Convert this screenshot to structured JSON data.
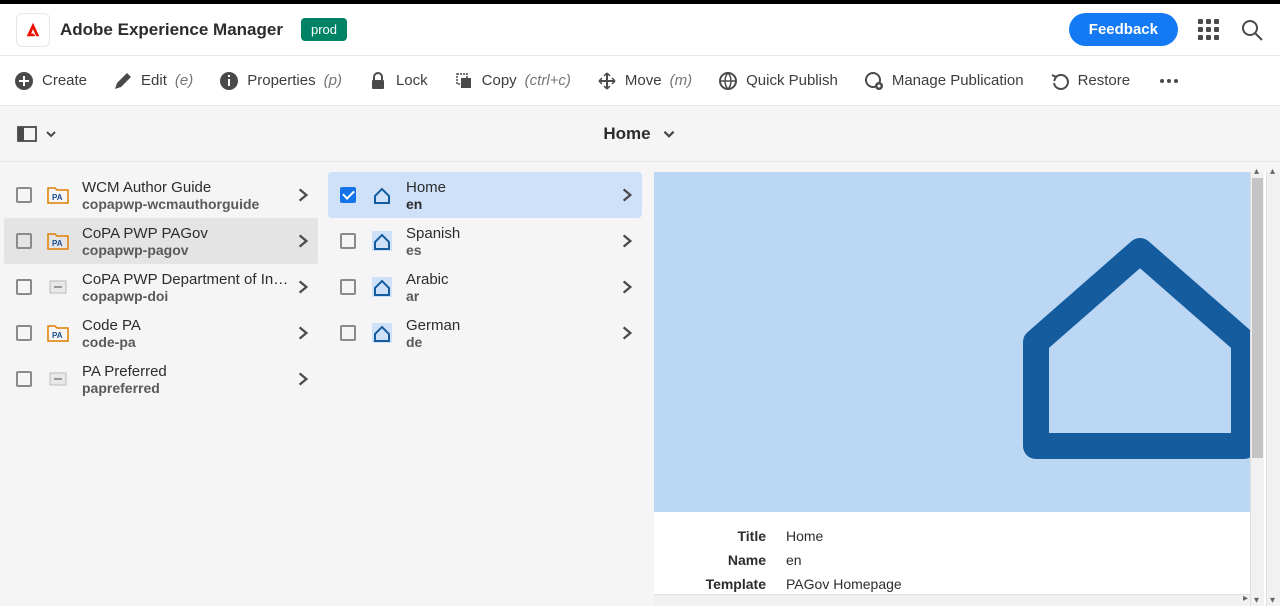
{
  "header": {
    "app_title": "Adobe Experience Manager",
    "env_badge": "prod",
    "feedback_label": "Feedback"
  },
  "toolbar": {
    "create": "Create",
    "edit": "Edit",
    "edit_key": "(e)",
    "properties": "Properties",
    "properties_key": "(p)",
    "lock": "Lock",
    "copy": "Copy",
    "copy_key": "(ctrl+c)",
    "move": "Move",
    "move_key": "(m)",
    "quick_publish": "Quick Publish",
    "manage_publication": "Manage Publication",
    "restore": "Restore"
  },
  "breadcrumb": {
    "current": "Home"
  },
  "column1": [
    {
      "title": "WCM Author Guide",
      "name": "copapwp-wcmauthorguide",
      "icon": "pa"
    },
    {
      "title": "CoPA PWP PAGov",
      "name": "copapwp-pagov",
      "icon": "pa",
      "selected": true
    },
    {
      "title": "CoPA PWP Department of Ins…",
      "name": "copapwp-doi",
      "icon": "dash"
    },
    {
      "title": "Code PA",
      "name": "code-pa",
      "icon": "pa"
    },
    {
      "title": "PA Preferred",
      "name": "papreferred",
      "icon": "dash"
    }
  ],
  "column2": [
    {
      "title": "Home",
      "name": "en",
      "checked": true,
      "selected": true
    },
    {
      "title": "Spanish",
      "name": "es"
    },
    {
      "title": "Arabic",
      "name": "ar"
    },
    {
      "title": "German",
      "name": "de"
    }
  ],
  "preview": {
    "meta": {
      "title_label": "Title",
      "title_value": "Home",
      "name_label": "Name",
      "name_value": "en",
      "template_label": "Template",
      "template_value": "PAGov Homepage"
    }
  }
}
